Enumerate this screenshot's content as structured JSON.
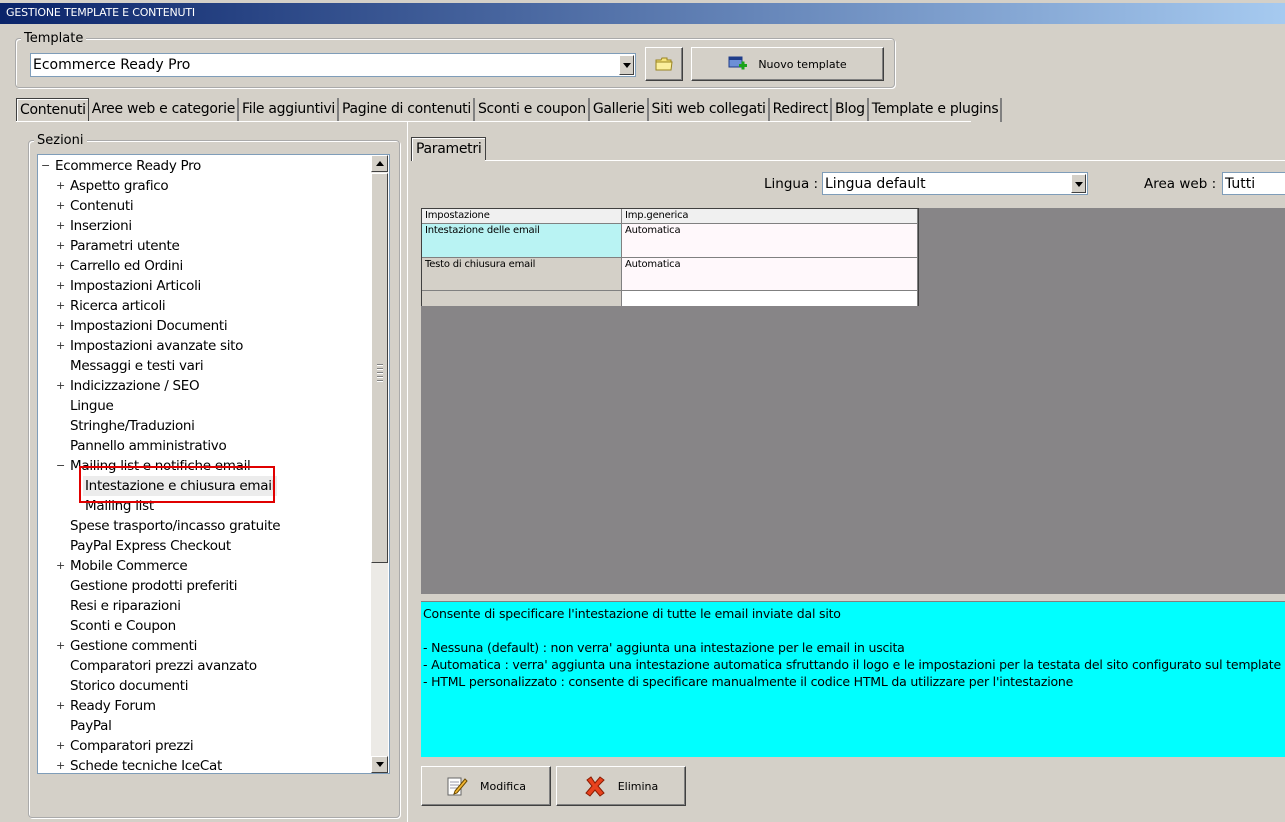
{
  "window": {
    "title": "GESTIONE TEMPLATE E CONTENUTI"
  },
  "template_group": {
    "legend": "Template",
    "selected": "Ecommerce Ready Pro",
    "new_button": "Nuovo template"
  },
  "tabs": [
    "Contenuti",
    "Aree web e categorie",
    "File aggiuntivi",
    "Pagine di contenuti",
    "Sconti e coupon",
    "Gallerie",
    "Siti web collegati",
    "Redirect",
    "Blog",
    "Template e plugins"
  ],
  "sections": {
    "legend": "Sezioni",
    "items": [
      {
        "label": "Ecommerce Ready Pro",
        "level": 0,
        "expander": "−"
      },
      {
        "label": "Aspetto grafico",
        "level": 1,
        "expander": "+"
      },
      {
        "label": "Contenuti",
        "level": 1,
        "expander": "+"
      },
      {
        "label": "Inserzioni",
        "level": 1,
        "expander": "+"
      },
      {
        "label": "Parametri utente",
        "level": 1,
        "expander": "+"
      },
      {
        "label": "Carrello ed Ordini",
        "level": 1,
        "expander": "+"
      },
      {
        "label": "Impostazioni Articoli",
        "level": 1,
        "expander": "+"
      },
      {
        "label": "Ricerca articoli",
        "level": 1,
        "expander": "+"
      },
      {
        "label": "Impostazioni Documenti",
        "level": 1,
        "expander": "+"
      },
      {
        "label": "Impostazioni avanzate sito",
        "level": 1,
        "expander": "+"
      },
      {
        "label": "Messaggi e testi vari",
        "level": 1,
        "expander": ""
      },
      {
        "label": "Indicizzazione / SEO",
        "level": 1,
        "expander": "+"
      },
      {
        "label": "Lingue",
        "level": 1,
        "expander": ""
      },
      {
        "label": "Stringhe/Traduzioni",
        "level": 1,
        "expander": ""
      },
      {
        "label": "Pannello amministrativo",
        "level": 1,
        "expander": ""
      },
      {
        "label": "Mailing list e notifiche email",
        "level": 1,
        "expander": "−"
      },
      {
        "label": "Intestazione e chiusura email",
        "level": 2,
        "expander": "",
        "selected": true
      },
      {
        "label": "Mailing list",
        "level": 2,
        "expander": ""
      },
      {
        "label": "Spese trasporto/incasso gratuite",
        "level": 1,
        "expander": ""
      },
      {
        "label": "PayPal Express Checkout",
        "level": 1,
        "expander": ""
      },
      {
        "label": "Mobile Commerce",
        "level": 1,
        "expander": "+"
      },
      {
        "label": "Gestione prodotti preferiti",
        "level": 1,
        "expander": ""
      },
      {
        "label": "Resi e riparazioni",
        "level": 1,
        "expander": ""
      },
      {
        "label": "Sconti e Coupon",
        "level": 1,
        "expander": ""
      },
      {
        "label": "Gestione commenti",
        "level": 1,
        "expander": "+"
      },
      {
        "label": "Comparatori prezzi avanzato",
        "level": 1,
        "expander": ""
      },
      {
        "label": "Storico documenti",
        "level": 1,
        "expander": ""
      },
      {
        "label": "Ready Forum",
        "level": 1,
        "expander": "+"
      },
      {
        "label": "PayPal",
        "level": 1,
        "expander": ""
      },
      {
        "label": "Comparatori prezzi",
        "level": 1,
        "expander": "+"
      },
      {
        "label": "Schede tecniche IceCat",
        "level": 1,
        "expander": "+"
      }
    ]
  },
  "params": {
    "tab": "Parametri",
    "lingua_label": "Lingua :",
    "lingua_value": "Lingua default",
    "area_label": "Area web :",
    "area_value": "Tutti",
    "grid": {
      "headers": [
        "Impostazione",
        "Imp.generica"
      ],
      "rows": [
        [
          "Intestazione delle email",
          "Automatica"
        ],
        [
          "Testo di chiusura email",
          "Automatica"
        ],
        [
          "",
          ""
        ]
      ]
    },
    "description": [
      "Consente di specificare l'intestazione di tutte le email inviate dal sito",
      "",
      "- Nessuna (default) : non verra' aggiunta una intestazione per le email in uscita",
      "- Automatica : verra' aggiunta una intestazione automatica sfruttando il logo e le impostazioni per la testata del sito configurato sul template",
      "- HTML personalizzato : consente di specificare manualmente il codice HTML da utilizzare per l'intestazione"
    ],
    "buttons": {
      "edit": "Modifica",
      "delete": "Elimina"
    }
  },
  "colors": {
    "highlight_cell": "#b9f3f3",
    "description_bg": "#00ffff",
    "grid_area": "#878587",
    "red_box": "#e00000"
  }
}
